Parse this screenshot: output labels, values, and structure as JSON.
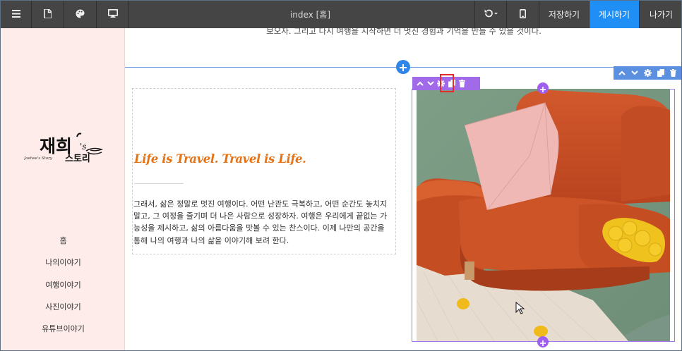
{
  "toolbar": {
    "title": "index [홈]",
    "save_label": "저장하기",
    "publish_label": "게시하기",
    "exit_label": "나가기"
  },
  "sidebar": {
    "logo_text": "재희's 스토리",
    "logo_subtext": "Jaehee's Story",
    "nav": [
      {
        "label": "홈"
      },
      {
        "label": "나의이야기"
      },
      {
        "label": "여행이야기"
      },
      {
        "label": "사진이야기"
      },
      {
        "label": "유튜브이야기"
      }
    ]
  },
  "content": {
    "top_text": "보오자. 그리고 다시 여행을 시작하면 더 멋진 경험과 기억을 만들 수 있을 것이다.",
    "headline": "Life is Travel. Travel is Life.",
    "body_lines": [
      "그래서, 삶은 정말로 멋진 여행이다. 어떤 난관도 극복하고, 어떤 순간도 놓치지",
      "말고, 그 여정을 즐기며 더 나은 사람으로 성장하자. 여행은 우리에게 끝없는 가",
      "능성을 제시하고, 삶의 아름다움을 맛볼 수 있는 찬스이다. 이제 나만의 공간을",
      "통해 나의 여행과 나의 삶을 이야기해 보려 한다."
    ]
  },
  "colors": {
    "toolbar_bg": "#454545",
    "publish_bg": "#1f8ef5",
    "sidebar_bg": "#fdecea",
    "headline": "#e67216",
    "section_accent": "#5b8fe0",
    "element_accent": "#a06ae8",
    "highlight": "#e52b2b"
  },
  "icons": {
    "toolbar": [
      "menu-icon",
      "page-icon",
      "palette-icon",
      "desktop-icon",
      "undo-icon",
      "mobile-icon"
    ],
    "section_tools": [
      "chevron-up-icon",
      "chevron-down-icon",
      "gear-icon",
      "copy-icon",
      "trash-icon"
    ],
    "element_tools": [
      "chevron-up-icon",
      "chevron-down-icon",
      "gear-icon",
      "copy-icon",
      "trash-icon"
    ]
  }
}
